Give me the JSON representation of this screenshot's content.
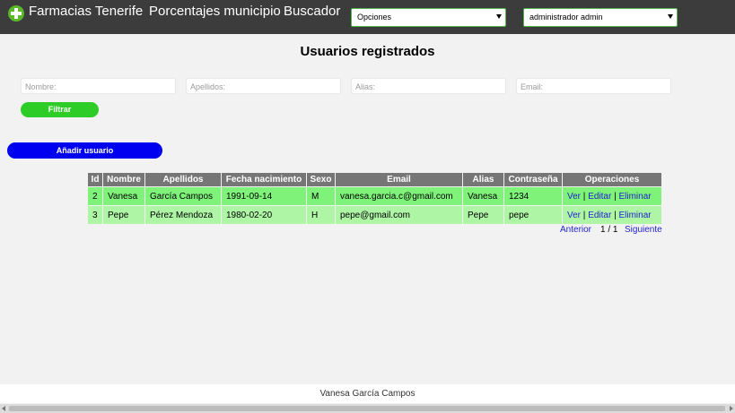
{
  "nav": {
    "logo_icon": "pharmacy-cross-icon",
    "links": [
      "Farmacias Tenerife",
      "Porcentajes municipio",
      "Buscador"
    ],
    "options_select": "Opciones",
    "user_select": "administrador admin"
  },
  "page": {
    "title": "Usuarios registrados"
  },
  "filters": {
    "nombre_placeholder": "Nombre:",
    "apellidos_placeholder": "Apellidos:",
    "alias_placeholder": "Alias:",
    "email_placeholder": "Email:",
    "filter_button": "Filtrar"
  },
  "add_button": "Añadir usuario",
  "table": {
    "headers": [
      "Id",
      "Nombre",
      "Apellidos",
      "Fecha nacimiento",
      "Sexo",
      "Email",
      "Alias",
      "Contraseña",
      "Operaciones"
    ],
    "rows": [
      {
        "id": "2",
        "nombre": "Vanesa",
        "apellidos": "García Campos",
        "fecha": "1991-09-14",
        "sexo": "M",
        "email": "vanesa.garcia.c@gmail.com",
        "alias": "Vanesa",
        "password": "1234"
      },
      {
        "id": "3",
        "nombre": "Pepe",
        "apellidos": "Pérez Mendoza",
        "fecha": "1980-02-20",
        "sexo": "H",
        "email": "pepe@gmail.com",
        "alias": "Pepe",
        "password": "pepe"
      }
    ],
    "operations": {
      "view": "Ver",
      "edit": "Editar",
      "delete": "Eliminar",
      "separator": "|"
    }
  },
  "pagination": {
    "prev": "Anterior",
    "page": "1 / 1",
    "next": "Siguiente"
  },
  "footer": "Vanesa García Campos",
  "colors": {
    "topbar": "#3c3c3c",
    "filter_button": "#2ecc26",
    "add_button": "#0000f0",
    "header_bg": "#767676",
    "row_even": "#7ff27a",
    "row_odd": "#aef5a5",
    "link": "#1f1fcc"
  }
}
